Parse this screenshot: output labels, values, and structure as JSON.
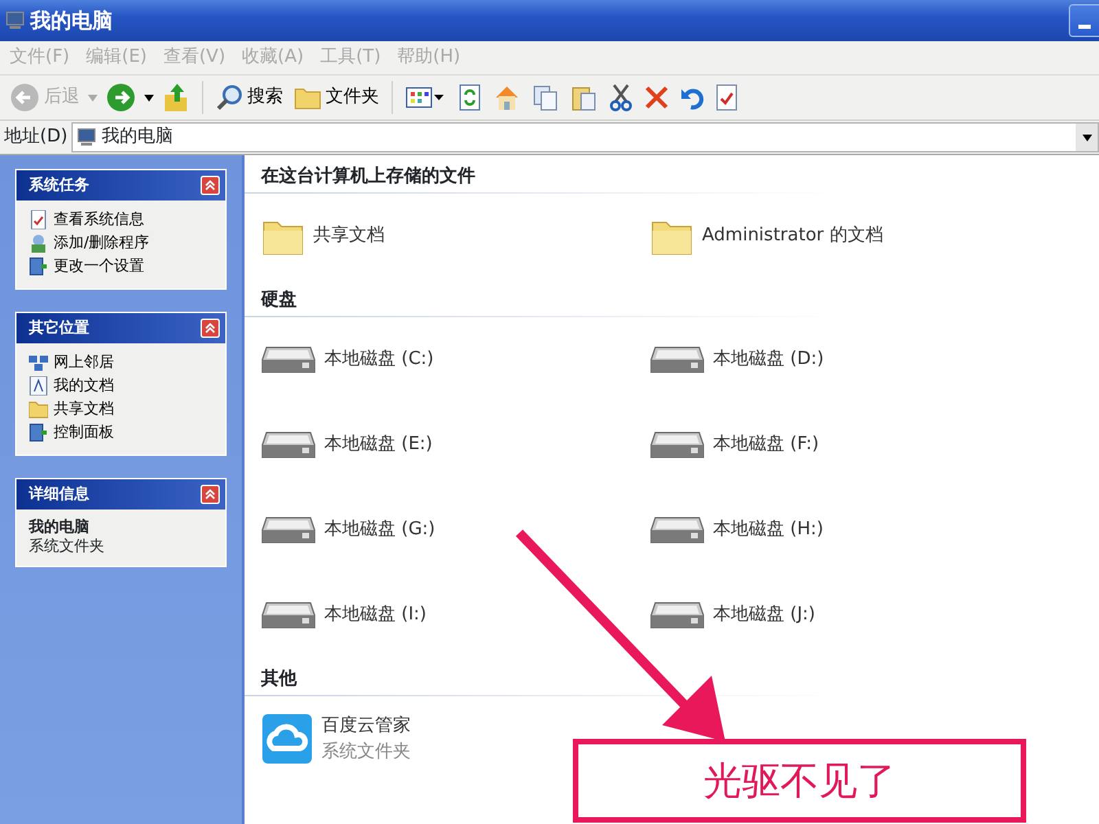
{
  "window": {
    "title": "我的电脑"
  },
  "menu": [
    {
      "label": "文件(F)"
    },
    {
      "label": "编辑(E)"
    },
    {
      "label": "查看(V)"
    },
    {
      "label": "收藏(A)"
    },
    {
      "label": "工具(T)"
    },
    {
      "label": "帮助(H)"
    }
  ],
  "toolbar": [
    {
      "kind": "back",
      "label": "后退",
      "disabled": true
    },
    {
      "kind": "forward"
    },
    {
      "kind": "up"
    },
    {
      "kind": "search",
      "label": "搜索"
    },
    {
      "kind": "folders",
      "label": "文件夹"
    },
    {
      "kind": "views"
    },
    {
      "kind": "refresh"
    },
    {
      "kind": "home"
    },
    {
      "kind": "copy"
    },
    {
      "kind": "paste"
    },
    {
      "kind": "cut"
    },
    {
      "kind": "delete"
    },
    {
      "kind": "undo"
    },
    {
      "kind": "properties"
    }
  ],
  "address": {
    "label": "地址(D)",
    "value": "我的电脑"
  },
  "sidebar": {
    "panels": [
      {
        "title": "系统任务",
        "expanded": true,
        "items": [
          {
            "kind": "info",
            "label": "查看系统信息"
          },
          {
            "kind": "programs",
            "label": "添加/删除程序"
          },
          {
            "kind": "settings",
            "label": "更改一个设置"
          }
        ]
      },
      {
        "title": "其它位置",
        "expanded": true,
        "items": [
          {
            "kind": "network",
            "label": "网上邻居"
          },
          {
            "kind": "documents",
            "label": "我的文档"
          },
          {
            "kind": "folder",
            "label": "共享文档"
          },
          {
            "kind": "settings",
            "label": "控制面板"
          }
        ]
      },
      {
        "title": "详细信息",
        "expanded": true,
        "details": {
          "name": "我的电脑",
          "type": "系统文件夹"
        }
      }
    ]
  },
  "content": {
    "groups": [
      {
        "title": "在这台计算机上存储的文件",
        "items": [
          {
            "kind": "folder",
            "label": "共享文档"
          },
          {
            "kind": "folder",
            "label": "Administrator 的文档"
          }
        ]
      },
      {
        "title": "硬盘",
        "items": [
          {
            "kind": "drive",
            "label": "本地磁盘 (C:)"
          },
          {
            "kind": "drive",
            "label": "本地磁盘 (D:)"
          },
          {
            "kind": "drive",
            "label": "本地磁盘 (E:)"
          },
          {
            "kind": "drive",
            "label": "本地磁盘 (F:)"
          },
          {
            "kind": "drive",
            "label": "本地磁盘 (G:)"
          },
          {
            "kind": "drive",
            "label": "本地磁盘 (H:)"
          },
          {
            "kind": "drive",
            "label": "本地磁盘 (I:)"
          },
          {
            "kind": "drive",
            "label": "本地磁盘 (J:)"
          }
        ]
      },
      {
        "title": "其他",
        "items": [
          {
            "kind": "app",
            "label": "百度云管家",
            "subtitle": "系统文件夹"
          }
        ]
      }
    ]
  },
  "annotation": {
    "text": "光驱不见了"
  }
}
